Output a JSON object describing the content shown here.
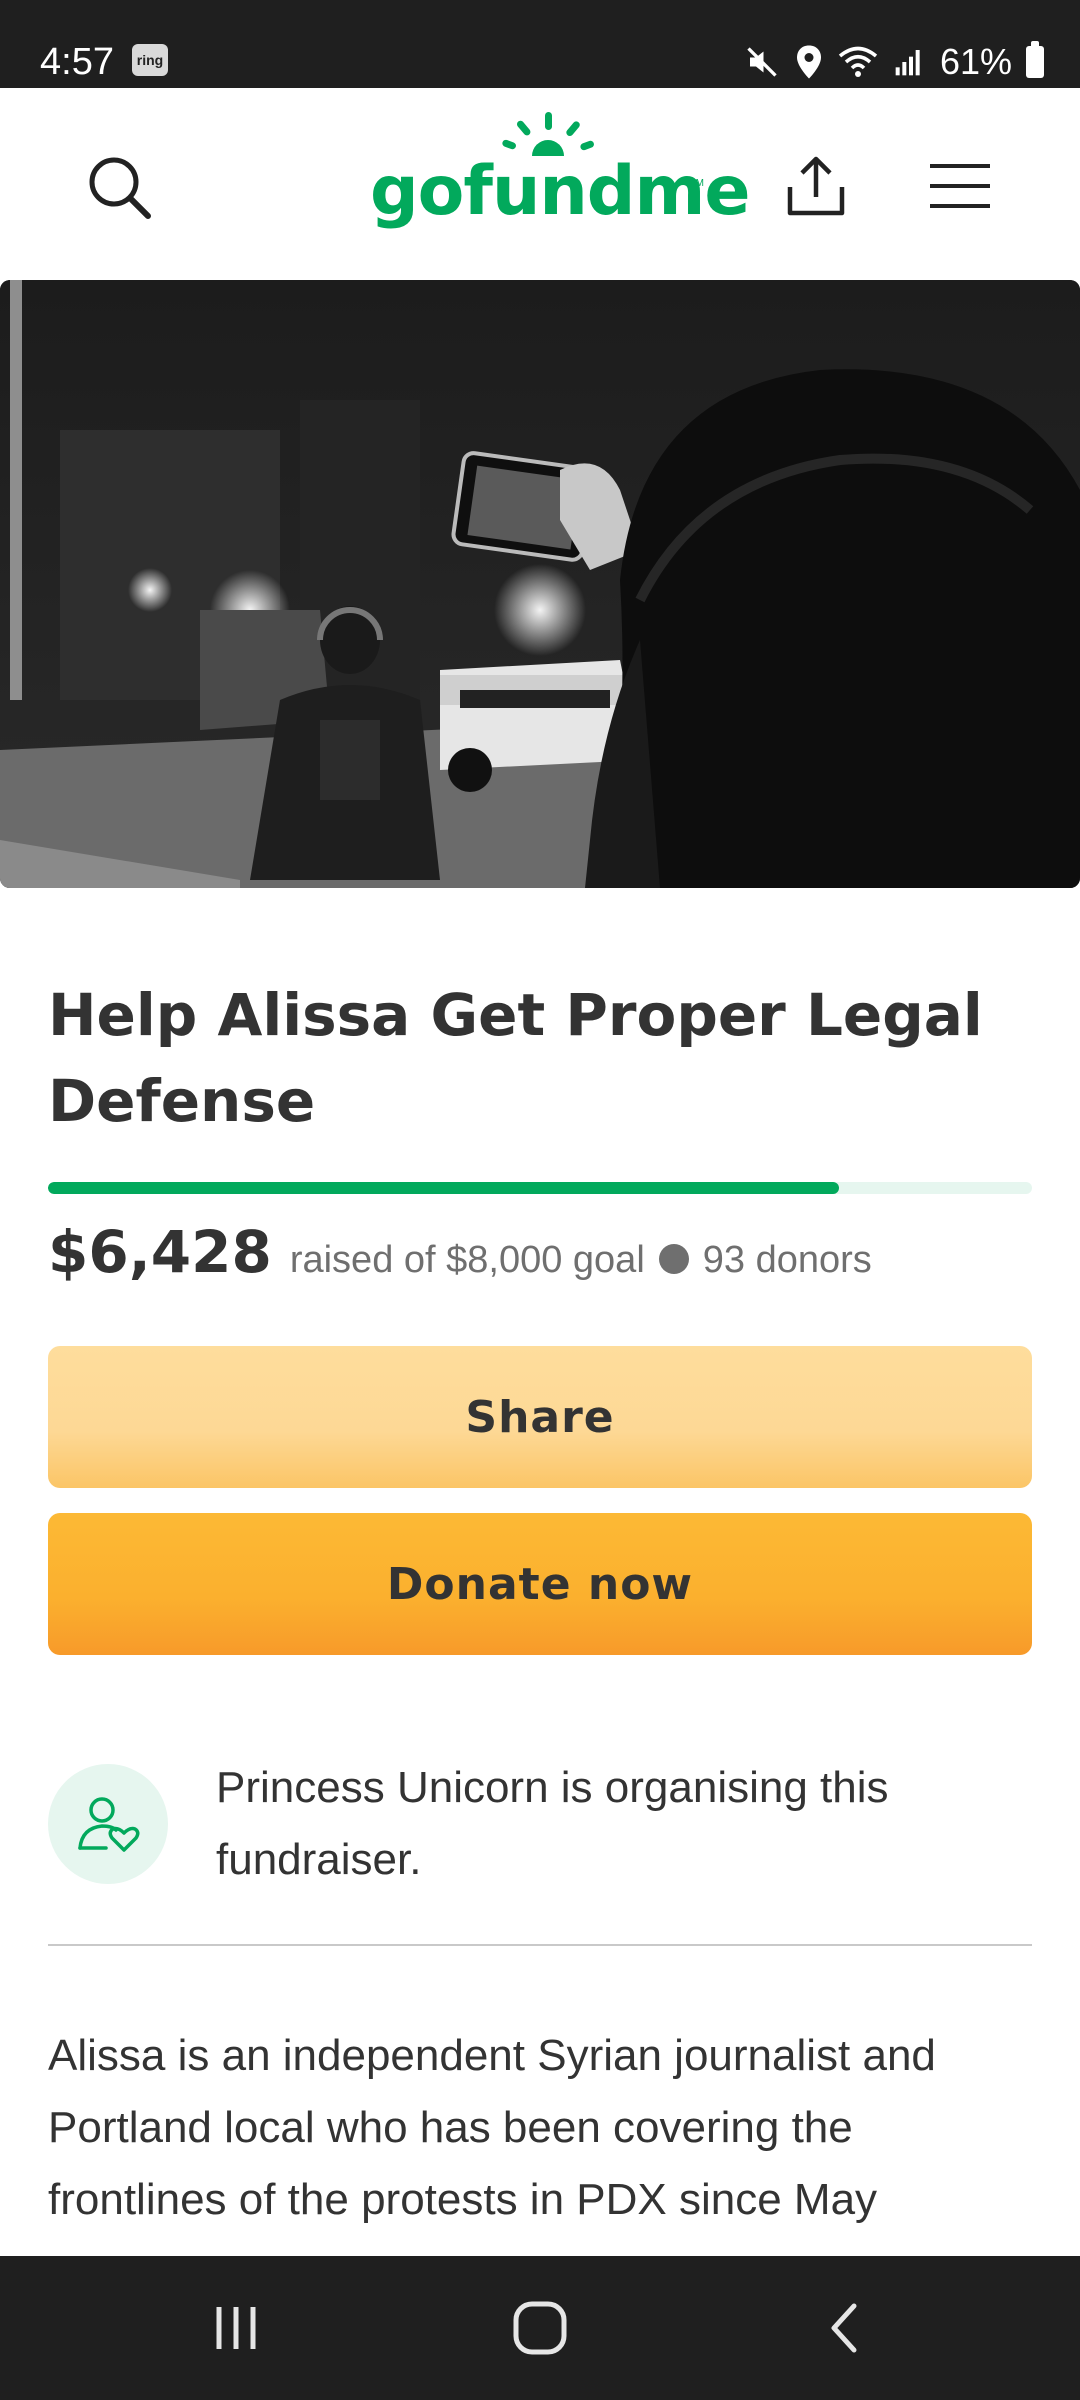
{
  "status_bar": {
    "time": "4:57",
    "ring_badge": "ring",
    "battery": "61%"
  },
  "header": {
    "logo_text": "gofundme",
    "logo_tm": "TM",
    "icons": [
      "search-icon",
      "share-icon",
      "menu-icon"
    ]
  },
  "campaign": {
    "title": "Help Alissa Get Proper Legal Defense",
    "raised": "$6,428",
    "raised_of_goal": "raised of $8,000 goal",
    "donors": "93 donors",
    "progress_fraction": 0.8035
  },
  "actions": {
    "share_label": "Share",
    "donate_label": "Donate now"
  },
  "organiser": {
    "text": "Princess Unicorn is organising this fundraiser."
  },
  "story": {
    "text": "Alissa is an independent Syrian journalist and Portland local who has been covering the frontlines of the protests in PDX since May"
  },
  "colors": {
    "brand_green": "#02a95c",
    "share_yellow": "#fdd895",
    "donate_orange": "#fbb02e"
  }
}
